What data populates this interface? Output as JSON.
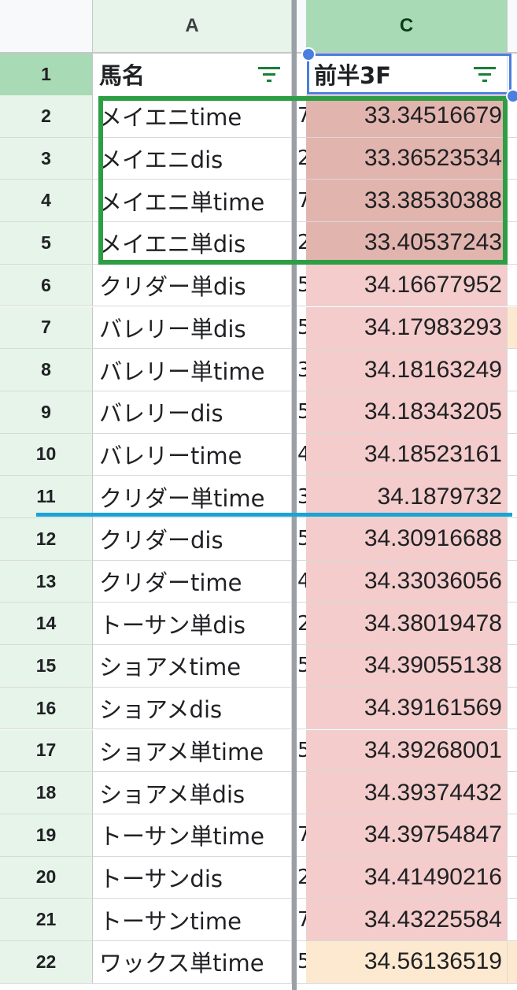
{
  "columns": {
    "a": "A",
    "c": "C"
  },
  "header_row": {
    "number": "1",
    "name_label": "馬名",
    "value_label": "前半3F"
  },
  "colors": {
    "dark_pink": "#e2b4ae",
    "light_pink": "#f3cccb",
    "peach": "#fde9cf",
    "highlight_green": "#2e9e45",
    "separator_blue": "#1aa3d4",
    "selection_blue": "#4a7ee0"
  },
  "rows": [
    {
      "number": "2",
      "name": "メイエニtime",
      "hidden": "7",
      "value": "33.34516679",
      "fill": "dark_pink",
      "next": ""
    },
    {
      "number": "3",
      "name": "メイエニdis",
      "hidden": "2",
      "value": "33.36523534",
      "fill": "dark_pink",
      "next": ""
    },
    {
      "number": "4",
      "name": "メイエニ単time",
      "hidden": "7",
      "value": "33.38530388",
      "fill": "dark_pink",
      "next": ""
    },
    {
      "number": "5",
      "name": "メイエニ単dis",
      "hidden": "2",
      "value": "33.40537243",
      "fill": "dark_pink",
      "next": ""
    },
    {
      "number": "6",
      "name": "クリダー単dis",
      "hidden": "5",
      "value": "34.16677952",
      "fill": "light_pink",
      "next": ""
    },
    {
      "number": "7",
      "name": "バレリー単dis",
      "hidden": "5",
      "value": "34.17983293",
      "fill": "light_pink",
      "next": "orange"
    },
    {
      "number": "8",
      "name": "バレリー単time",
      "hidden": "3",
      "value": "34.18163249",
      "fill": "light_pink",
      "next": ""
    },
    {
      "number": "9",
      "name": "バレリーdis",
      "hidden": "5",
      "value": "34.18343205",
      "fill": "light_pink",
      "next": ""
    },
    {
      "number": "10",
      "name": "バレリーtime",
      "hidden": "4",
      "value": "34.18523161",
      "fill": "light_pink",
      "next": ""
    },
    {
      "number": "11",
      "name": "クリダー単time",
      "hidden": "3",
      "value": "34.1879732",
      "fill": "light_pink",
      "next": ""
    },
    {
      "number": "12",
      "name": "クリダーdis",
      "hidden": "5",
      "value": "34.30916688",
      "fill": "light_pink",
      "next": ""
    },
    {
      "number": "13",
      "name": "クリダーtime",
      "hidden": "4",
      "value": "34.33036056",
      "fill": "light_pink",
      "next": ""
    },
    {
      "number": "14",
      "name": "トーサン単dis",
      "hidden": "2",
      "value": "34.38019478",
      "fill": "light_pink",
      "next": ""
    },
    {
      "number": "15",
      "name": "ショアメtime",
      "hidden": "5",
      "value": "34.39055138",
      "fill": "light_pink",
      "next": ""
    },
    {
      "number": "16",
      "name": "ショアメdis",
      "hidden": "",
      "value": "34.39161569",
      "fill": "light_pink",
      "next": ""
    },
    {
      "number": "17",
      "name": "ショアメ単time",
      "hidden": "5",
      "value": "34.39268001",
      "fill": "light_pink",
      "next": ""
    },
    {
      "number": "18",
      "name": "ショアメ単dis",
      "hidden": "",
      "value": "34.39374432",
      "fill": "light_pink",
      "next": ""
    },
    {
      "number": "19",
      "name": "トーサン単time",
      "hidden": "7",
      "value": "34.39754847",
      "fill": "light_pink",
      "next": ""
    },
    {
      "number": "20",
      "name": "トーサンdis",
      "hidden": "2",
      "value": "34.41490216",
      "fill": "light_pink",
      "next": ""
    },
    {
      "number": "21",
      "name": "トーサンtime",
      "hidden": "7",
      "value": "34.43225584",
      "fill": "light_pink",
      "next": ""
    },
    {
      "number": "22",
      "name": "ワックス単time",
      "hidden": "5",
      "value": "34.56136519",
      "fill": "peach",
      "next": "orange"
    }
  ]
}
